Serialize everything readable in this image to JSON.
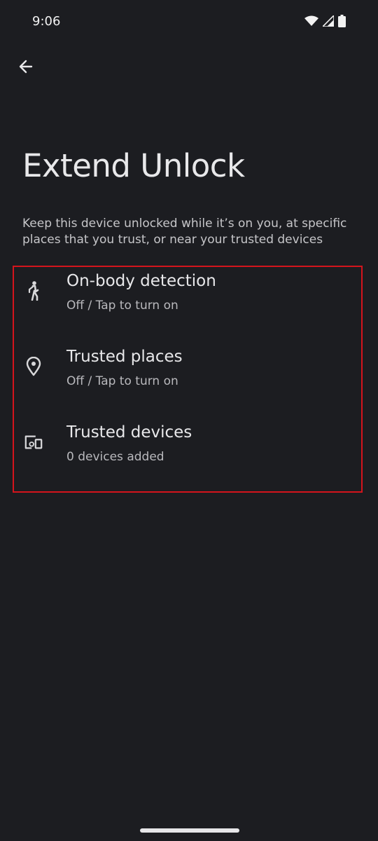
{
  "status_bar": {
    "time": "9:06",
    "icons": [
      "wifi-icon",
      "signal-icon",
      "battery-icon"
    ]
  },
  "header": {
    "back_icon": "arrow-back-icon",
    "title": "Extend Unlock"
  },
  "description": "Keep this device unlocked while it’s on you, at specific places that you trust, or near your trusted devices",
  "items": [
    {
      "icon": "walking-person-icon",
      "title": "On-body detection",
      "subtitle": "Off / Tap to turn on"
    },
    {
      "icon": "location-pin-icon",
      "title": "Trusted places",
      "subtitle": "Off / Tap to turn on"
    },
    {
      "icon": "devices-icon",
      "title": "Trusted devices",
      "subtitle": "0 devices added"
    }
  ],
  "colors": {
    "background": "#1c1d21",
    "highlight_border": "#d4141c"
  }
}
